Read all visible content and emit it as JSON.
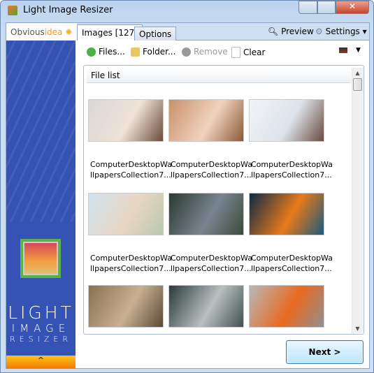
{
  "window": {
    "title": "Light Image Resizer"
  },
  "sidebar": {
    "logo_main": "Obvious",
    "logo_accent": "idea",
    "brand_line1": "LIGHT",
    "brand_line2": "IMAGE",
    "brand_line3": "RESIZER",
    "collapse_glyph": "^"
  },
  "tabs": [
    {
      "label": "Images [127]",
      "active": true
    },
    {
      "label": "Options",
      "active": false
    }
  ],
  "top_right": {
    "preview": "Preview",
    "settings": "Settings"
  },
  "toolbar": {
    "files": "Files...",
    "folder": "Folder...",
    "remove": "Remove",
    "clear": "Clear"
  },
  "file_list": {
    "header": "File list",
    "items": [
      {
        "line1": "ComputerDesktopWa",
        "line2": "llpapersCollection7...",
        "colors": [
          "#d8d8d8",
          "#f0e2d6",
          "#6a4a3a"
        ]
      },
      {
        "line1": "ComputerDesktopWa",
        "line2": "llpapersCollection7...",
        "colors": [
          "#c8906a",
          "#f1d3bd",
          "#8a5a36"
        ]
      },
      {
        "line1": "ComputerDesktopWa",
        "line2": "llpapersCollection7...",
        "colors": [
          "#f2f4f6",
          "#dde3ea",
          "#6a4a40"
        ]
      },
      {
        "line1": "ComputerDesktopWa",
        "line2": "llpapersCollection7...",
        "colors": [
          "#cfe3f0",
          "#e9d6c2",
          "#b8c8b0"
        ]
      },
      {
        "line1": "ComputerDesktopWa",
        "line2": "llpapersCollection7...",
        "colors": [
          "#2a3a30",
          "#7a8490",
          "#3b4a3a"
        ]
      },
      {
        "line1": "ComputerDesktopWa",
        "line2": "llpapersCollection7...",
        "colors": [
          "#0c2a44",
          "#e87a1a",
          "#1a5a7a"
        ]
      },
      {
        "line1": "",
        "line2": "",
        "colors": [
          "#8a7050",
          "#c8b090",
          "#5a4a38"
        ]
      },
      {
        "line1": "",
        "line2": "",
        "colors": [
          "#2a3a3a",
          "#b8c0c0",
          "#405050"
        ]
      },
      {
        "line1": "",
        "line2": "",
        "colors": [
          "#b8b8b8",
          "#e86a20",
          "#909090"
        ]
      }
    ]
  },
  "buttons": {
    "next": "Next >"
  }
}
